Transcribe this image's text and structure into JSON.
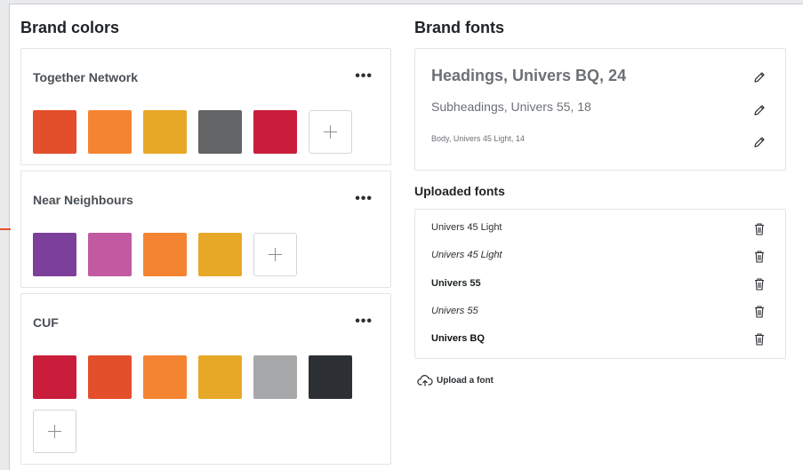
{
  "brand_colors": {
    "title": "Brand colors",
    "palettes": [
      {
        "name": "Together Network",
        "menu": "•••",
        "colors": [
          "#e34e2b",
          "#f58432",
          "#e8a827",
          "#626466",
          "#c91d3b"
        ]
      },
      {
        "name": "Near Neighbours",
        "menu": "•••",
        "colors": [
          "#7d3f9c",
          "#c25aa1",
          "#f58432",
          "#e8a827"
        ]
      },
      {
        "name": "CUF",
        "menu": "•••",
        "colors": [
          "#c91d3b",
          "#e34e2b",
          "#f58432",
          "#e8a827",
          "#a6a8aa",
          "#2c2f33"
        ]
      }
    ]
  },
  "brand_fonts": {
    "title": "Brand fonts",
    "styles": [
      {
        "label": "Headings, Univers BQ, 24",
        "icon": "pencil-icon"
      },
      {
        "label": "Subheadings, Univers 55, 18",
        "icon": "pencil-icon"
      },
      {
        "label": "Body, Univers 45 Light, 14",
        "icon": "pencil-icon"
      }
    ]
  },
  "uploaded_fonts": {
    "title": "Uploaded fonts",
    "items": [
      {
        "name": "Univers 45 Light",
        "icon": "trash-icon"
      },
      {
        "name": "Univers 45 Light",
        "icon": "trash-icon"
      },
      {
        "name": "Univers 55",
        "icon": "trash-icon"
      },
      {
        "name": "Univers 55",
        "icon": "trash-icon"
      },
      {
        "name": "Univers BQ",
        "icon": "trash-icon"
      }
    ],
    "upload_label": "Upload a font",
    "upload_icon": "cloud-upload-icon"
  }
}
